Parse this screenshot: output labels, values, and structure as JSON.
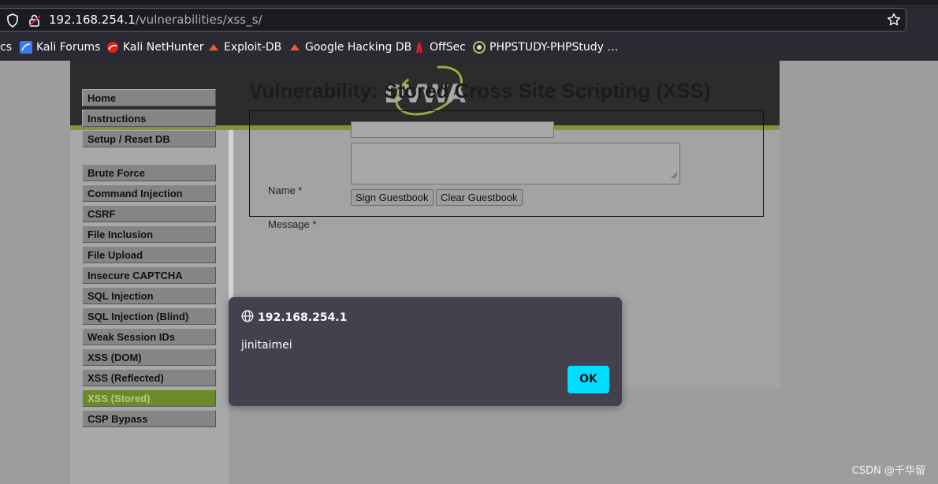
{
  "browser": {
    "url_host": "192.168.254.1",
    "url_path": "/vulnerabilities/xss_s/",
    "bookmarks": [
      {
        "label": "cs",
        "icon": "none"
      },
      {
        "label": "Kali Forums",
        "icon": "kali-forums-icon"
      },
      {
        "label": "Kali NetHunter",
        "icon": "kali-nethunter-icon"
      },
      {
        "label": "Exploit-DB",
        "icon": "exploit-db-icon"
      },
      {
        "label": "Google Hacking DB",
        "icon": "ghdb-icon"
      },
      {
        "label": "OffSec",
        "icon": "offsec-icon"
      },
      {
        "label": "PHPSTUDY-PHPStudy …",
        "icon": "phpstudy-icon"
      }
    ]
  },
  "page": {
    "logo_text": "DVWA",
    "title": "Vulnerability: Stored Cross Site Scripting (XSS)",
    "menu": [
      "Home",
      "Instructions",
      "Setup / Reset DB",
      "Brute Force",
      "Command Injection",
      "CSRF",
      "File Inclusion",
      "File Upload",
      "Insecure CAPTCHA",
      "SQL Injection",
      "SQL Injection (Blind)",
      "Weak Session IDs",
      "XSS (DOM)",
      "XSS (Reflected)",
      "XSS (Stored)",
      "CSP Bypass"
    ],
    "active_menu": "XSS (Stored)",
    "form": {
      "name_label": "Name *",
      "name_value": "",
      "message_label": "Message *",
      "message_value": "",
      "sign_button": "Sign Guestbook",
      "clear_button": "Clear Guestbook"
    }
  },
  "dialog": {
    "origin": "192.168.254.1",
    "message": "jinitaimei",
    "ok_label": "OK"
  },
  "watermark": "CSDN @千华留",
  "colors": {
    "accent_ok": "#00ddff",
    "dvwa_green": "#7a9836",
    "dialog_bg": "#42414d"
  }
}
